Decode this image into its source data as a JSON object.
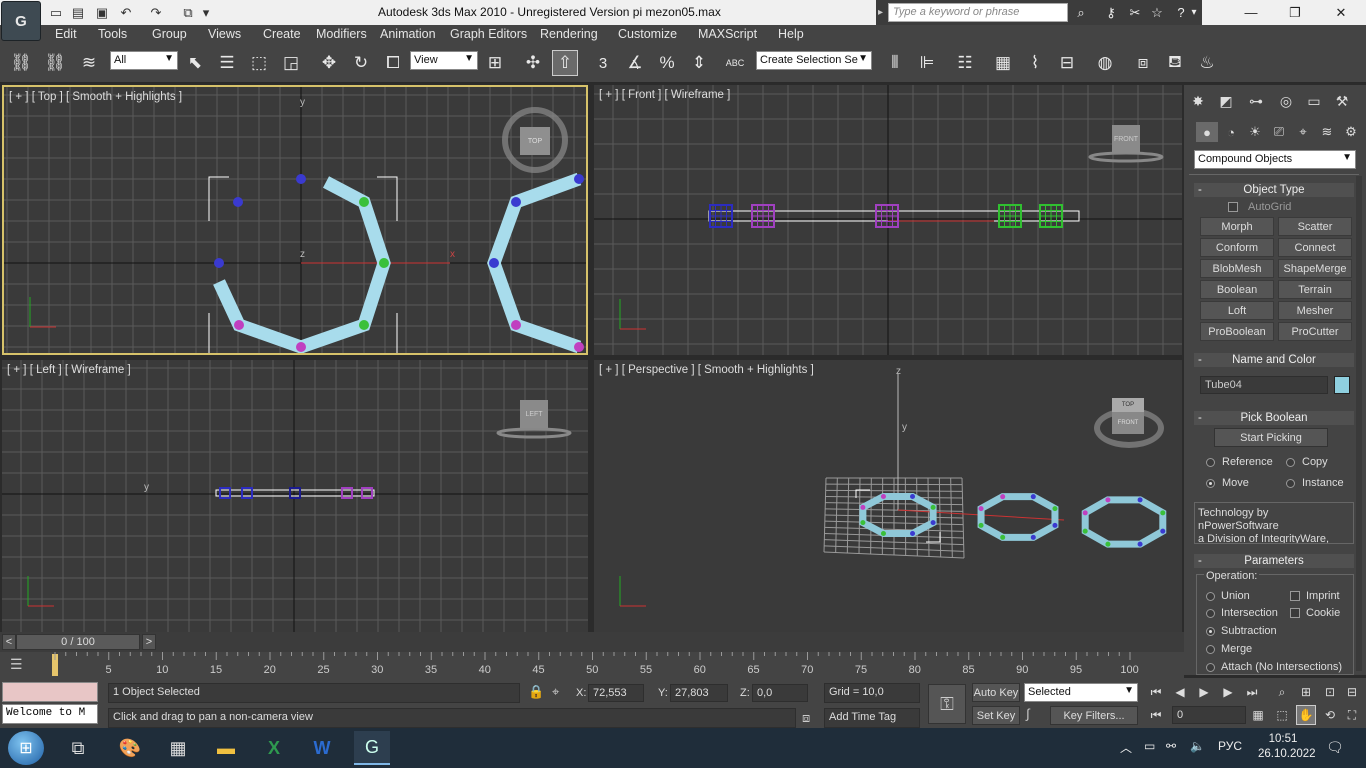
{
  "window": {
    "title": "Autodesk 3ds Max  2010  - Unregistered Version        pi mezon05.max",
    "logo_text": "G",
    "search_placeholder": "Type a keyword or phrase"
  },
  "menu": [
    "Edit",
    "Tools",
    "Group",
    "Views",
    "Create",
    "Modifiers",
    "Animation",
    "Graph Editors",
    "Rendering",
    "Customize",
    "MAXScript",
    "Help"
  ],
  "toolbar": {
    "selection_filter": "All",
    "ref_coord": "View",
    "named_selection": "Create Selection Se",
    "snap_label": "3",
    "snap_percent": "%",
    "abc_label": "ABC"
  },
  "viewports": {
    "top": {
      "label": "[ + ] [ Top ] [ Smooth + Highlights ]",
      "cube": "TOP",
      "axis_y": "y",
      "axis_x": "x",
      "axis_z": "z"
    },
    "front": {
      "label": "[ + ] [ Front ] [ Wireframe ]",
      "cube": "FRONT"
    },
    "left": {
      "label": "[ + ] [ Left ] [ Wireframe ]",
      "cube": "LEFT",
      "axis_y": "y"
    },
    "perspective": {
      "label": "[ + ] [ Perspective ] [ Smooth + Highlights ]",
      "cube_top": "TOP",
      "cube_front": "FRONT",
      "axis_z": "z",
      "axis_y": "y"
    }
  },
  "command_panel": {
    "category": "Compound Objects",
    "object_type": {
      "title": "Object Type",
      "autogrid": "AutoGrid",
      "buttons": [
        "Morph",
        "Scatter",
        "Conform",
        "Connect",
        "BlobMesh",
        "ShapeMerge",
        "Boolean",
        "Terrain",
        "Loft",
        "Mesher",
        "ProBoolean",
        "ProCutter"
      ]
    },
    "name_and_color": {
      "title": "Name and Color",
      "name": "Tube04",
      "color": "#8fd0e0"
    },
    "pick_boolean": {
      "title": "Pick Boolean",
      "start_picking": "Start Picking",
      "options": [
        {
          "label": "Reference",
          "on": false
        },
        {
          "label": "Copy",
          "on": false
        },
        {
          "label": "Move",
          "on": true
        },
        {
          "label": "Instance",
          "on": false
        }
      ]
    },
    "technology_note": [
      "Technology by nPowerSoftware",
      "a Division of IntegrityWare,"
    ],
    "parameters": {
      "title": "Parameters",
      "operation_label": "Operation:",
      "operations": [
        {
          "label": "Union",
          "on": false
        },
        {
          "label": "Intersection",
          "on": false
        },
        {
          "label": "Subtraction",
          "on": true
        },
        {
          "label": "Merge",
          "on": false
        },
        {
          "label": "Attach (No Intersections)",
          "on": false
        }
      ],
      "checks": [
        {
          "label": "Imprint",
          "on": false
        },
        {
          "label": "Cookie",
          "on": false
        }
      ]
    }
  },
  "timeline": {
    "frame_label": "0 / 100",
    "prev": "<",
    "next": ">",
    "ticks": [
      "5",
      "10",
      "15",
      "20",
      "25",
      "30",
      "35",
      "40",
      "45",
      "50",
      "55",
      "60",
      "65",
      "70",
      "75",
      "80",
      "85",
      "90",
      "95",
      "100"
    ]
  },
  "status": {
    "selected": "1 Object Selected",
    "prompt": "Click and drag to pan a non-camera view",
    "script_listener": "Welcome to M",
    "x_label": "X:",
    "x_value": "72,553",
    "y_label": "Y:",
    "y_value": "27,803",
    "z_label": "Z:",
    "z_value": "0,0",
    "grid": "Grid = 10,0",
    "add_time_tag": "Add Time Tag",
    "auto_key": "Auto Key",
    "set_key": "Set Key",
    "key_mode": "Selected",
    "key_filters": "Key Filters...",
    "frame": "0"
  },
  "taskbar": {
    "language": "РУС",
    "time": "10:51",
    "date": "26.10.2022"
  }
}
